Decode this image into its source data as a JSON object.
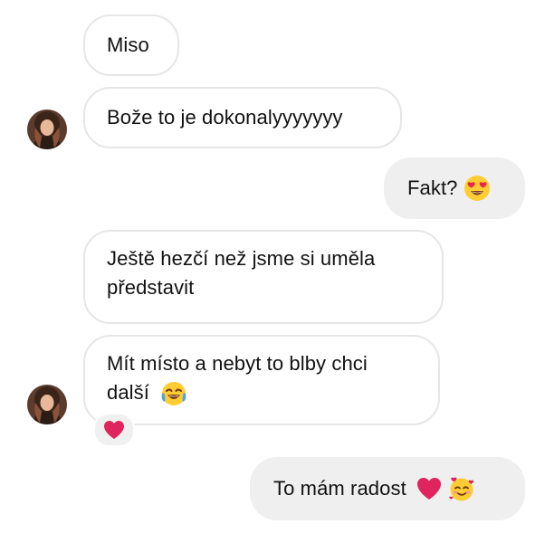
{
  "conversation": {
    "messages": [
      {
        "id": "m1",
        "side": "incoming",
        "text": "Miso"
      },
      {
        "id": "m2",
        "side": "incoming",
        "text": "Bože to je dokonalyyyyyyy"
      },
      {
        "id": "m3",
        "side": "outgoing",
        "text": "Fakt?",
        "emoji": "heart-eyes-emoji"
      },
      {
        "id": "m4",
        "side": "incoming",
        "line1": "Ještě hezčí než jsme si uměla",
        "line2": "představit"
      },
      {
        "id": "m5",
        "side": "incoming",
        "line1": "Mít místo a nebyt to blby chci",
        "line2": "další",
        "emoji": "tears-of-joy-emoji",
        "reaction": "red-heart-emoji"
      },
      {
        "id": "m6",
        "side": "outgoing",
        "text": "To mám radost",
        "emojis": [
          "red-heart-emoji",
          "smiling-face-with-hearts-emoji"
        ]
      }
    ]
  },
  "colors": {
    "incoming_bubble_bg": "#ffffff",
    "incoming_bubble_border": "#e6e6e6",
    "outgoing_bubble_bg": "#efefef",
    "text": "#111111",
    "heart": "#e0245e",
    "emoji_yellow": "#ffcc33"
  }
}
